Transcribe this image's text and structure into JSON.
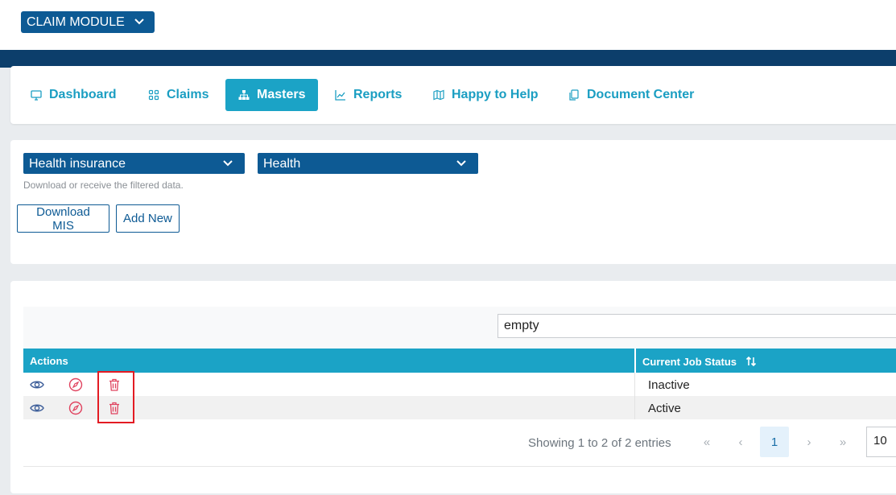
{
  "header": {
    "module_select": {
      "value": "CLAIM MODULE",
      "icon": "chevron-down-icon"
    }
  },
  "nav": {
    "items": [
      {
        "label": "Dashboard",
        "icon": "monitor-icon",
        "active": false
      },
      {
        "label": "Claims",
        "icon": "grid-icon",
        "active": false
      },
      {
        "label": "Masters",
        "icon": "hierarchy-icon",
        "active": true
      },
      {
        "label": "Reports",
        "icon": "chart-line-icon",
        "active": false
      },
      {
        "label": "Happy to Help",
        "icon": "map-icon",
        "active": false
      },
      {
        "label": "Document Center",
        "icon": "documents-icon",
        "active": false
      }
    ]
  },
  "filters": {
    "insurance_type": "Health insurance",
    "product": "Health",
    "hint": "Download or receive the filtered data.",
    "download_label": "Download MIS",
    "add_label": "Add New"
  },
  "table": {
    "search_value": "empty",
    "columns": {
      "actions": "Actions",
      "status": "Current Job Status"
    },
    "rows": [
      {
        "status": "Inactive"
      },
      {
        "status": "Active"
      }
    ],
    "row_action_icons": [
      "eye-icon",
      "compass-icon",
      "trash-icon"
    ],
    "info": "Showing 1 to 2 of 2 entries",
    "pagination": {
      "first": "«",
      "prev": "‹",
      "current": "1",
      "next": "›",
      "last": "»"
    },
    "page_size": "10"
  },
  "colors": {
    "brand_dark": "#0d5a94",
    "navy_band": "#0c3e6b",
    "accent": "#1ba3c6",
    "danger_icon": "#e0435f",
    "view_icon": "#3e5f9a",
    "highlight": "#e31b23"
  }
}
